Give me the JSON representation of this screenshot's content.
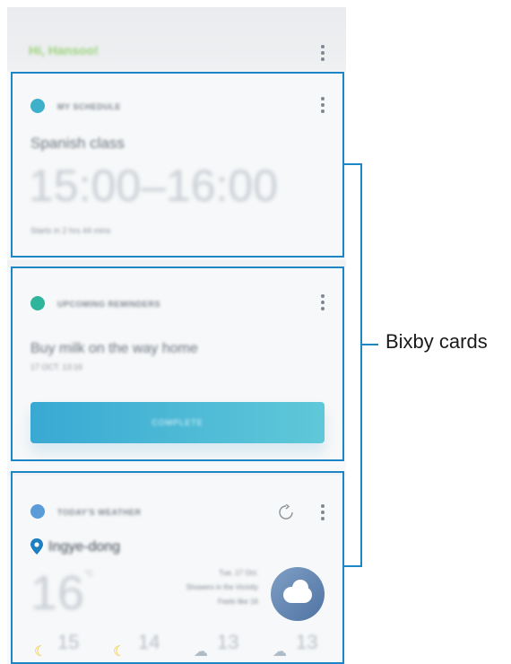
{
  "header": {
    "greeting": "Hi, Hansoo!"
  },
  "cards": {
    "schedule": {
      "title": "MY SCHEDULE",
      "event": "Spanish class",
      "time": "15:00–16:00",
      "subtext": "Starts in 2 hrs 44 mins"
    },
    "reminders": {
      "title": "UPCOMING REMINDERS",
      "reminder": "Buy milk on the way home",
      "datetime": "17 OCT. 13:16",
      "button": "COMPLETE"
    },
    "weather": {
      "title": "TODAY'S WEATHER",
      "location": "Ingye-dong",
      "temp": "16",
      "unit": "°C",
      "date": "Tue, 17 Oct.",
      "condition": "Showers in the Vicinity",
      "feels": "Feels like 16",
      "forecast": [
        {
          "icon": "moon-icon",
          "temp": "15"
        },
        {
          "icon": "moon-cloud-icon",
          "temp": "14"
        },
        {
          "icon": "cloud-icon",
          "temp": "13"
        },
        {
          "icon": "cloud-icon",
          "temp": "13"
        }
      ]
    }
  },
  "annotation": {
    "label": "Bixby cards"
  },
  "colors": {
    "frame": "#1c86c6",
    "accent": "#39a9d3",
    "greeting": "#9bd27a"
  }
}
